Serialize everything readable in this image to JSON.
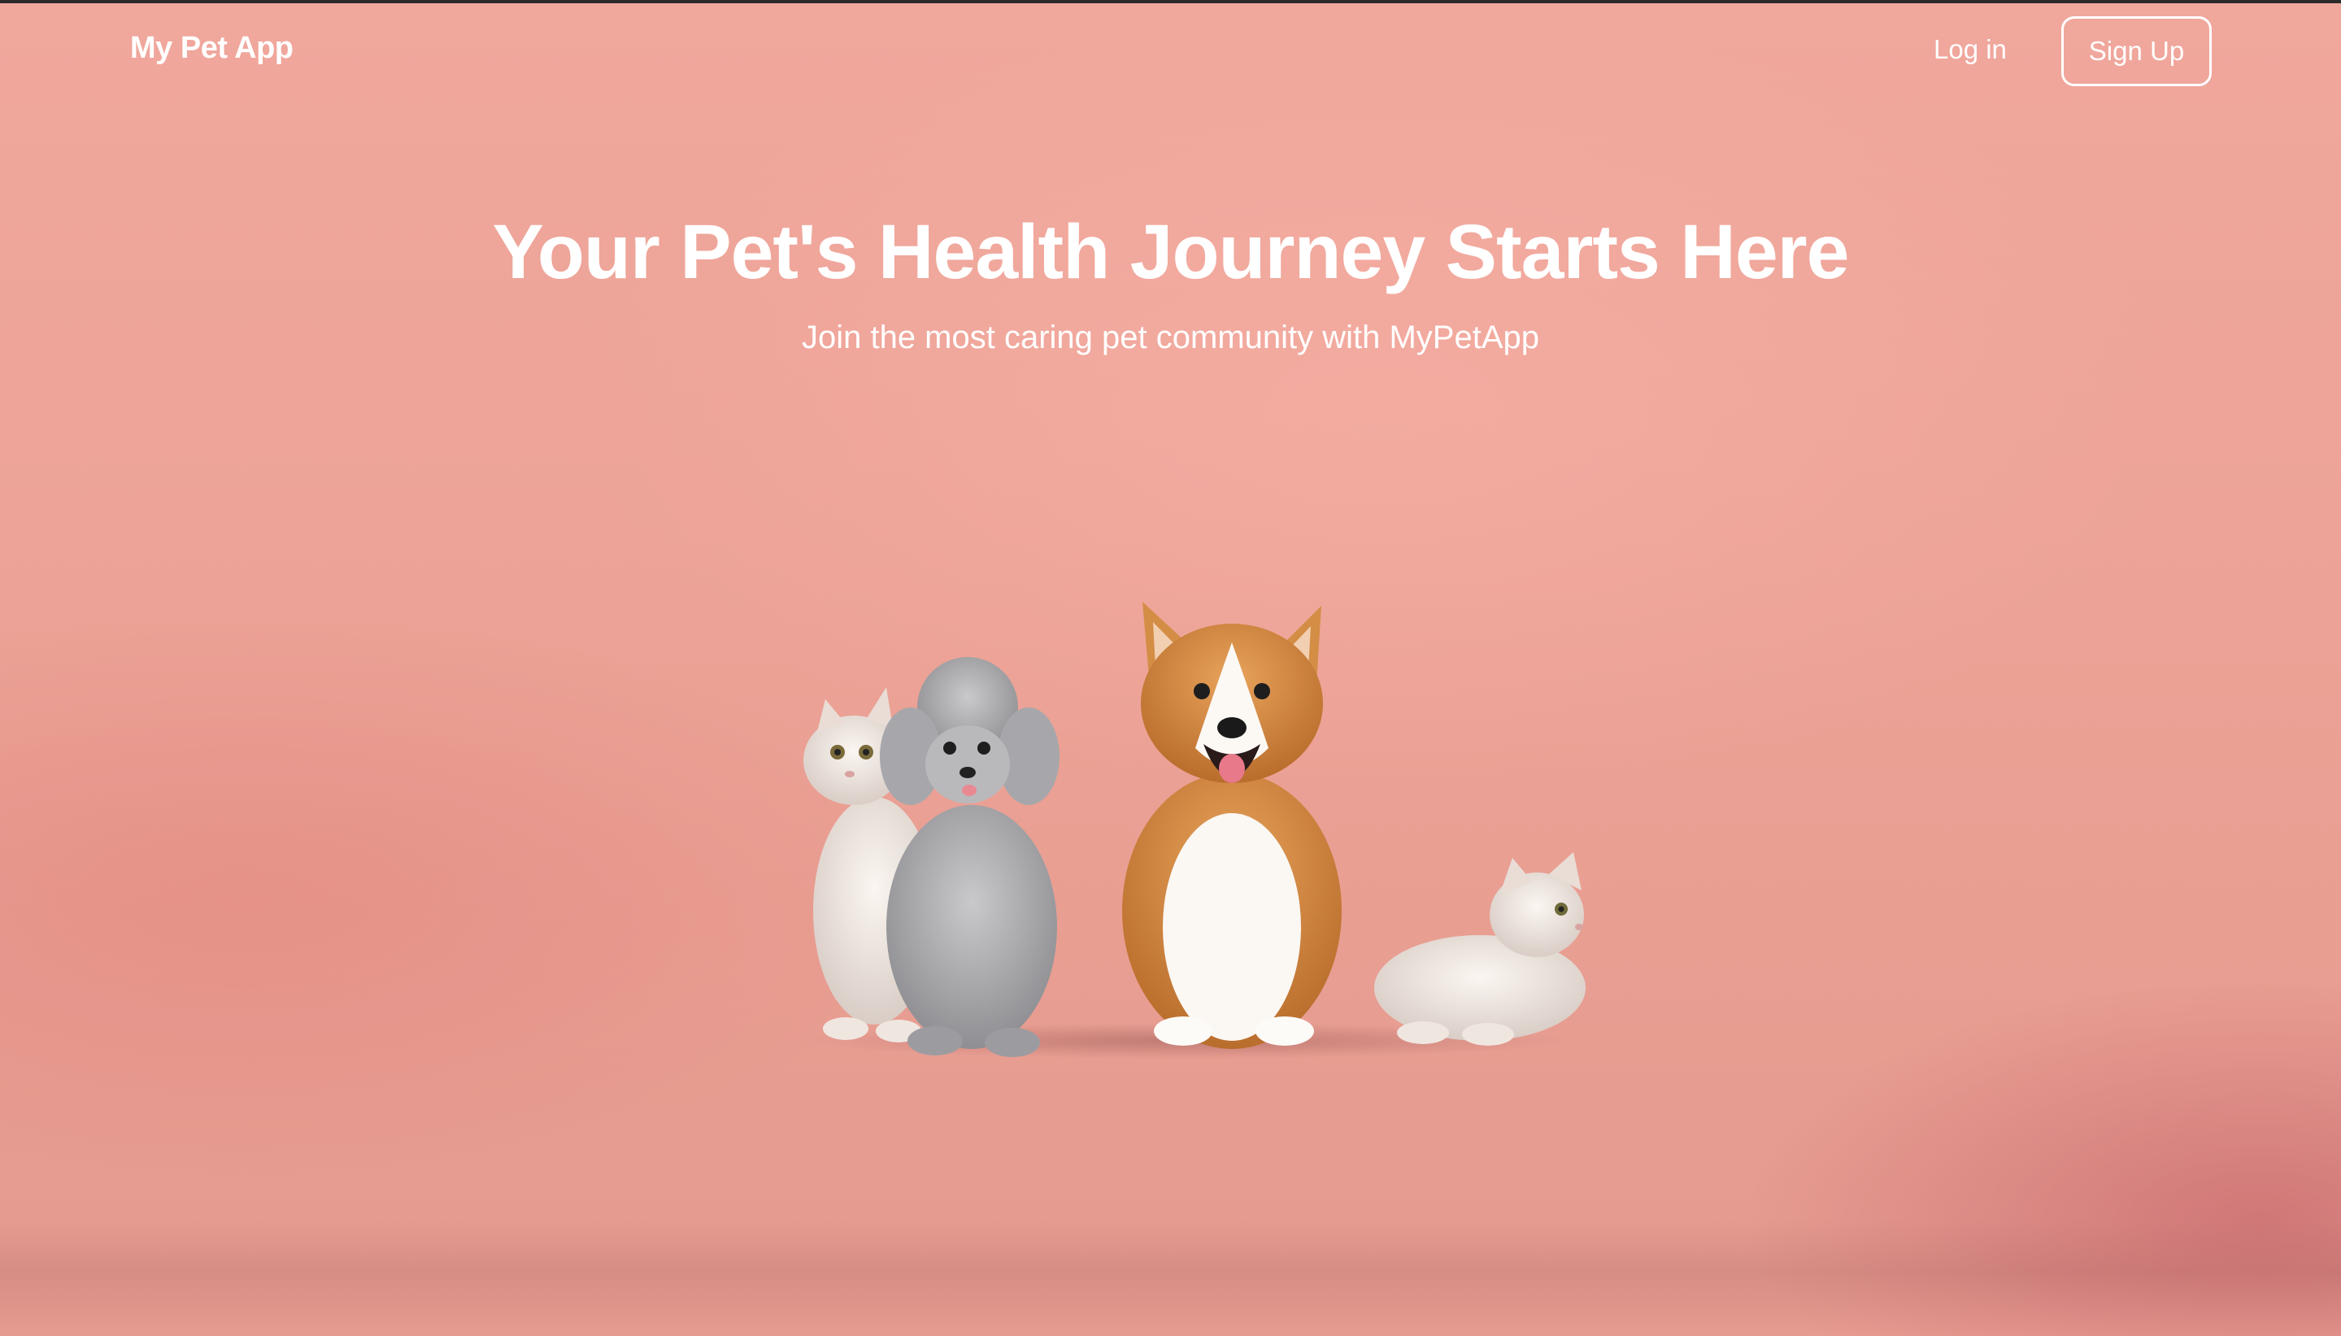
{
  "navbar": {
    "brand": "My Pet App",
    "login_label": "Log in",
    "signup_label": "Sign Up"
  },
  "hero": {
    "title": "Your Pet's Health Journey Starts Here",
    "subtitle": "Join the most caring pet community with MyPetApp"
  },
  "illustration": {
    "name": "pets-group-illustration",
    "animals": [
      "white-cat",
      "grey-poodle",
      "corgi",
      "lying-white-cat"
    ]
  },
  "colors": {
    "background": "#eda397",
    "text": "#ffffff"
  }
}
